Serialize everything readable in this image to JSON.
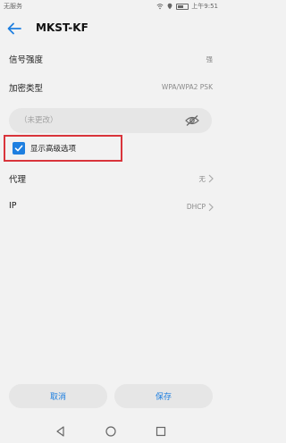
{
  "status_bar": {
    "carrier": "无服务",
    "time": "上午9:51"
  },
  "header": {
    "title": "MKST-KF"
  },
  "rows": {
    "signal": {
      "label": "信号强度",
      "value": "强"
    },
    "security": {
      "label": "加密类型",
      "value": "WPA/WPA2 PSK"
    },
    "proxy": {
      "label": "代理",
      "value": "无"
    },
    "ip": {
      "label": "IP",
      "value": "DHCP"
    }
  },
  "password": {
    "placeholder": "（未更改）"
  },
  "advanced": {
    "label": "显示高级选项",
    "checked": true
  },
  "buttons": {
    "cancel": "取消",
    "save": "保存"
  },
  "colors": {
    "accent": "#1e7fe0",
    "highlight_border": "#d9343b"
  },
  "icons": {
    "back": "arrow-left-icon",
    "eye": "eye-off-icon",
    "chevron": "chevron-right-icon",
    "checkbox": "checkbox-checked-icon"
  }
}
